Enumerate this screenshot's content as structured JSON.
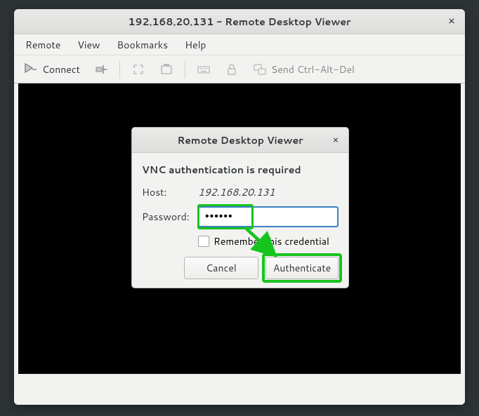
{
  "window": {
    "title": "192.168.20.131 - Remote Desktop Viewer"
  },
  "menubar": {
    "remote": "Remote",
    "view": "View",
    "bookmarks": "Bookmarks",
    "help": "Help"
  },
  "toolbar": {
    "connect": "Connect",
    "send_keys": "Send Ctrl-Alt-Del"
  },
  "dialog": {
    "title": "Remote Desktop Viewer",
    "message": "VNC authentication is required",
    "host_label": "Host:",
    "host_value": "192.168.20.131",
    "password_label": "Password:",
    "password_value": "••••••",
    "remember_label": "Remember this credential",
    "cancel": "Cancel",
    "authenticate": "Authenticate"
  }
}
